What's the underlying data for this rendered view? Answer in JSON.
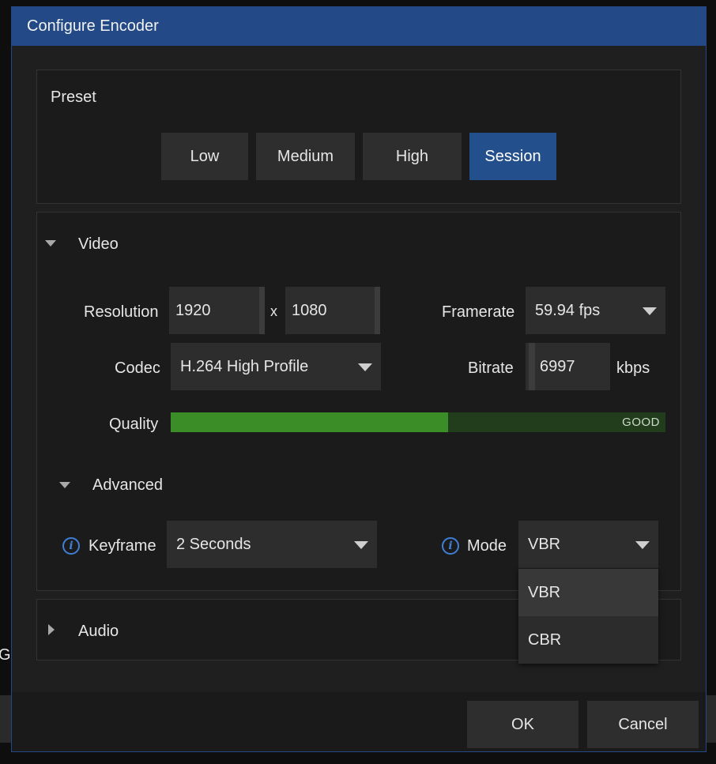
{
  "background": {
    "partial_text": "GI"
  },
  "dialog": {
    "title": "Configure Encoder"
  },
  "preset": {
    "label": "Preset",
    "buttons": [
      {
        "label": "Low",
        "active": false
      },
      {
        "label": "Medium",
        "active": false
      },
      {
        "label": "High",
        "active": false
      },
      {
        "label": "Session",
        "active": true
      }
    ]
  },
  "video": {
    "header": "Video",
    "resolution_label": "Resolution",
    "width_value": "1920",
    "separator": "x",
    "height_value": "1080",
    "framerate_label": "Framerate",
    "framerate_value": "59.94 fps",
    "codec_label": "Codec",
    "codec_value": "H.264 High Profile",
    "bitrate_label": "Bitrate",
    "bitrate_value": "6997",
    "bitrate_unit": "kbps",
    "quality_label": "Quality",
    "quality_text": "GOOD",
    "quality_level": 0.56
  },
  "advanced": {
    "header": "Advanced",
    "keyframe_label": "Keyframe",
    "keyframe_value": "2 Seconds",
    "mode_label": "Mode",
    "mode_value": "VBR",
    "mode_options": [
      "VBR",
      "CBR"
    ]
  },
  "audio": {
    "header": "Audio"
  },
  "footer": {
    "ok_label": "OK",
    "cancel_label": "Cancel"
  },
  "colors": {
    "accent": "#234a86",
    "quality_fill": "#3b8d27",
    "quality_track": "#213d1c",
    "info_icon": "#3f7fd6"
  }
}
